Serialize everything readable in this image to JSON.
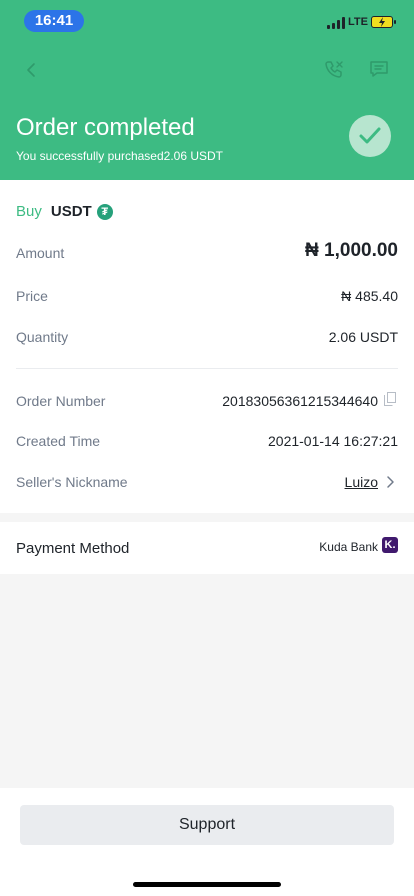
{
  "status_bar": {
    "time": "16:41",
    "network": "LTE"
  },
  "header": {
    "title": "Order completed",
    "subtitle": "You successfully purchased2.06 USDT"
  },
  "order": {
    "side": "Buy",
    "coin": "USDT",
    "coin_icon_glyph": "₮",
    "amount_label": "Amount",
    "amount_value": "₦ 1,000.00",
    "price_label": "Price",
    "price_value": "₦ 485.40",
    "quantity_label": "Quantity",
    "quantity_value": "2.06 USDT",
    "order_number_label": "Order Number",
    "order_number_value": "20183056361215344640",
    "created_time_label": "Created Time",
    "created_time_value": "2021-01-14 16:27:21",
    "seller_label": "Seller's Nickname",
    "seller_value": "Luizo"
  },
  "payment": {
    "label": "Payment Method",
    "bank": "Kuda Bank",
    "bank_logo_glyph": "K."
  },
  "footer": {
    "support_label": "Support"
  },
  "colors": {
    "brand_green": "#3dbb83",
    "time_pill": "#2c74e8",
    "tether": "#26a17b",
    "kuda": "#40196d"
  }
}
